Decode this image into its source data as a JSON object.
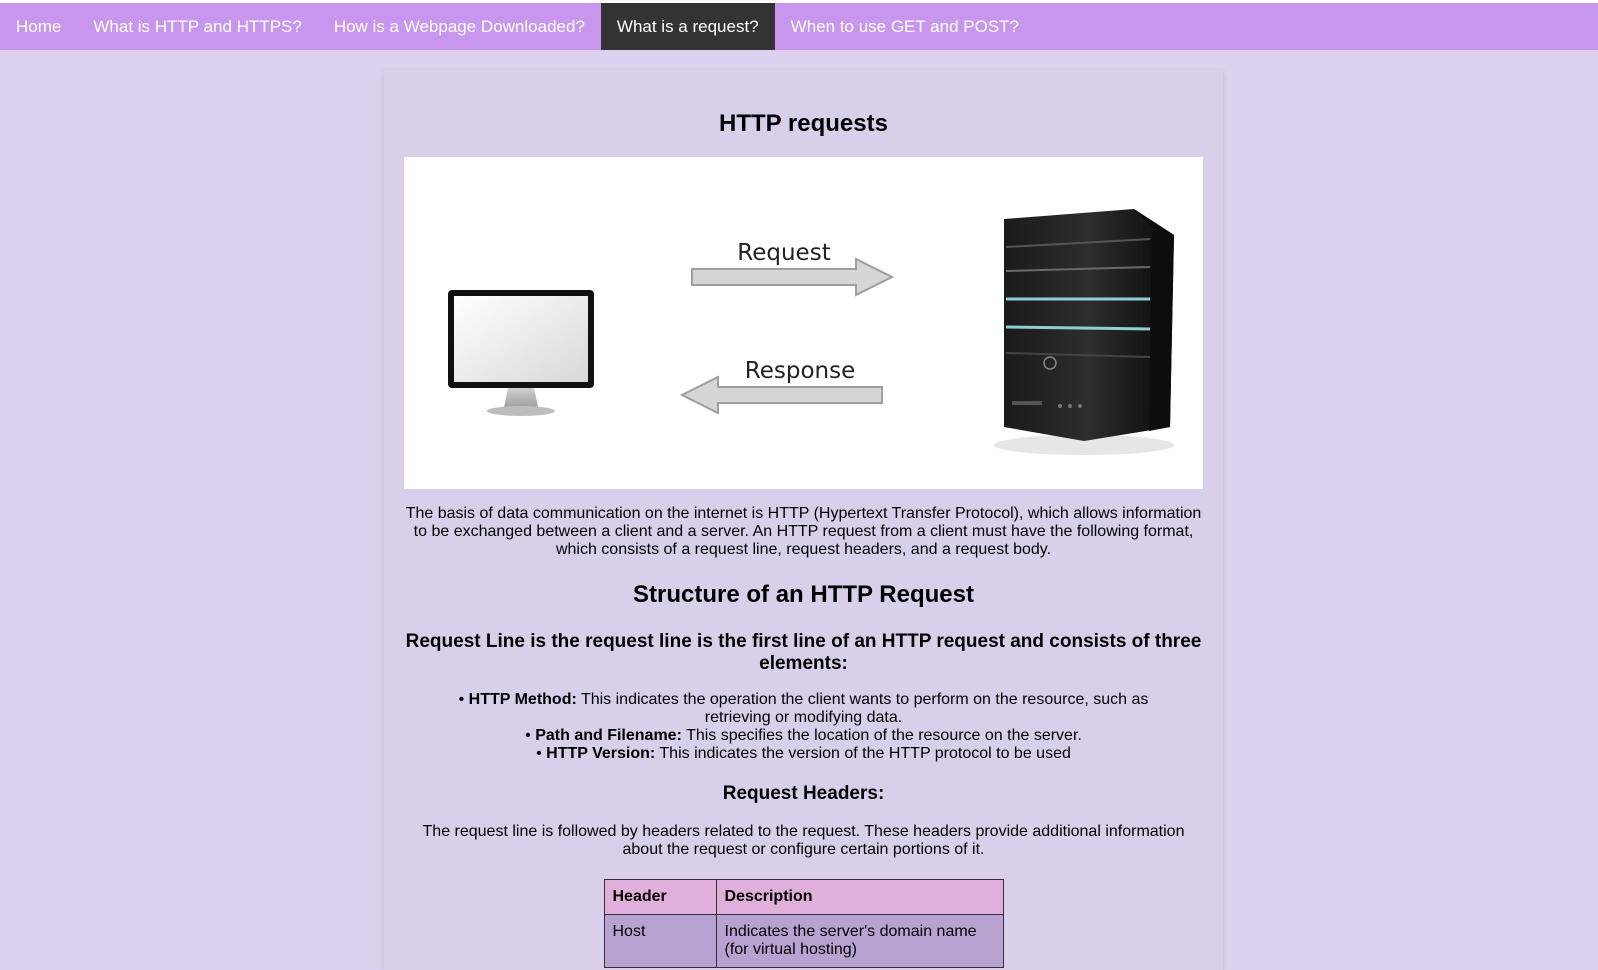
{
  "nav": {
    "items": [
      {
        "label": "Home",
        "active": false
      },
      {
        "label": "What is HTTP and HTTPS?",
        "active": false
      },
      {
        "label": "How is a Webpage Downloaded?",
        "active": false
      },
      {
        "label": "What is a request?",
        "active": true
      },
      {
        "label": "When to use GET and POST?",
        "active": false
      }
    ]
  },
  "colors": {
    "nav_bg": "#c896ee",
    "nav_active_bg": "#333333",
    "page_bg": "#dcd2f0",
    "card_bg": "#d9cfea",
    "table_header_bg": "#e0b0da",
    "table_cell_bg": "#b8a2d2"
  },
  "main": {
    "title": "HTTP requests",
    "diagram": {
      "request_label": "Request",
      "response_label": "Response",
      "client_icon": "monitor-icon",
      "server_icon": "server-tower-icon"
    },
    "intro": "The basis of data communication on the internet is HTTP (Hypertext Transfer Protocol), which allows information to be exchanged between a client and a server. An HTTP request from a client must have the following format, which consists of a request line, request headers, and a request body.",
    "structure_heading": "Structure of an HTTP Request",
    "request_line_heading": "Request Line is the request line is the first line of an HTTP request and consists of three elements:",
    "elements": [
      {
        "term": "HTTP Method:",
        "text": " This indicates the operation the client wants to perform on the resource, such as retrieving or modifying data."
      },
      {
        "term": "Path and Filename:",
        "text": " This specifies the location of the resource on the server."
      },
      {
        "term": "HTTP Version:",
        "text": " This indicates the version of the HTTP protocol to be used"
      }
    ],
    "headers_heading": "Request Headers:",
    "headers_desc": "The request line is followed by headers related to the request. These headers provide additional information about the request or configure certain portions of it.",
    "table": {
      "columns": [
        "Header",
        "Description"
      ],
      "rows": [
        {
          "header": "Host",
          "description": "Indicates the server's domain name (for virtual hosting)"
        }
      ]
    }
  }
}
